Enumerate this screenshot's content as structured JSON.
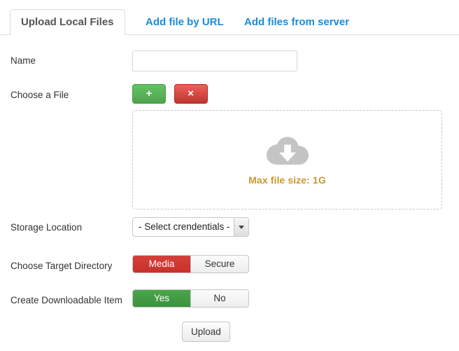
{
  "tabs": [
    {
      "label": "Upload Local Files",
      "active": true
    },
    {
      "label": "Add file by URL",
      "active": false
    },
    {
      "label": "Add files from server",
      "active": false
    }
  ],
  "form": {
    "name": {
      "label": "Name",
      "value": "",
      "placeholder": ""
    },
    "choose_file": {
      "label": "Choose a File",
      "add_button": "+",
      "remove_button": "×"
    },
    "dropzone": {
      "icon": "cloud-download-icon",
      "text": "Max file size: 1G",
      "text_color": "#c8992f"
    },
    "storage_location": {
      "label": "Storage Location",
      "selected": "- Select crendentials -"
    },
    "target_directory": {
      "label": "Choose Target Directory",
      "options": [
        "Media",
        "Secure"
      ],
      "selected": "Media",
      "selected_color": "#c9302c"
    },
    "downloadable_item": {
      "label": "Create Downloadable Item",
      "options": [
        "Yes",
        "No"
      ],
      "selected": "Yes",
      "selected_color": "#3d9140"
    },
    "submit": {
      "label": "Upload"
    }
  },
  "colors": {
    "link": "#1a8cd8",
    "add": "#51a351",
    "remove": "#bd362f",
    "border": "#dddddd"
  }
}
